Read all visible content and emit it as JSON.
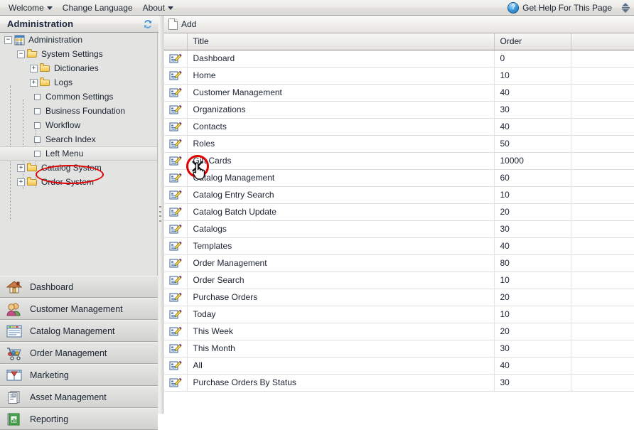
{
  "topbar": {
    "menu": [
      {
        "label": "Welcome",
        "caret": true
      },
      {
        "label": "Change Language",
        "caret": false
      },
      {
        "label": "About",
        "caret": true
      }
    ],
    "help_label": "Get Help For This Page",
    "help_icon": "question-mark-circle-icon",
    "expand_icon": "up-down-arrows-icon"
  },
  "left_panel": {
    "title": "Administration",
    "refresh_icon": "refresh-icon",
    "tree": [
      {
        "label": "Administration",
        "depth": 0,
        "icon": "admin-building-icon",
        "expander": "minus",
        "selected": false
      },
      {
        "label": "System Settings",
        "depth": 1,
        "icon": "folder-open-icon",
        "expander": "minus",
        "selected": false
      },
      {
        "label": "Dictionaries",
        "depth": 2,
        "icon": "folder-icon",
        "expander": "plus",
        "selected": false
      },
      {
        "label": "Logs",
        "depth": 2,
        "icon": "folder-icon",
        "expander": "plus",
        "selected": false
      },
      {
        "label": "Common Settings",
        "depth": 3,
        "icon": "none",
        "expander": "leaf",
        "selected": false
      },
      {
        "label": "Business Foundation",
        "depth": 3,
        "icon": "none",
        "expander": "leaf",
        "selected": false
      },
      {
        "label": "Workflow",
        "depth": 3,
        "icon": "none",
        "expander": "leaf",
        "selected": false
      },
      {
        "label": "Search Index",
        "depth": 3,
        "icon": "none",
        "expander": "leaf",
        "selected": false
      },
      {
        "label": "Left Menu",
        "depth": 3,
        "icon": "none",
        "expander": "leaf",
        "selected": true
      },
      {
        "label": "Catalog System",
        "depth": 1,
        "icon": "folder-icon",
        "expander": "plus",
        "selected": false
      },
      {
        "label": "Order System",
        "depth": 1,
        "icon": "folder-icon",
        "expander": "plus",
        "selected": false
      }
    ],
    "nav_buttons": [
      {
        "label": "Dashboard",
        "icon": "house-icon"
      },
      {
        "label": "Customer Management",
        "icon": "people-icon"
      },
      {
        "label": "Catalog Management",
        "icon": "catalog-window-icon"
      },
      {
        "label": "Order Management",
        "icon": "shopping-cart-icon"
      },
      {
        "label": "Marketing",
        "icon": "marketing-banner-icon"
      },
      {
        "label": "Asset Management",
        "icon": "assets-files-icon"
      },
      {
        "label": "Reporting",
        "icon": "report-book-icon"
      }
    ]
  },
  "content": {
    "toolbar": {
      "add_label": "Add",
      "add_icon": "new-page-icon"
    },
    "grid": {
      "columns": [
        "",
        "Title",
        "Order",
        ""
      ],
      "row_icon": "edit-row-icon",
      "rows": [
        {
          "title": "Dashboard",
          "order": "0",
          "indent": 0
        },
        {
          "title": "Home",
          "order": "10",
          "indent": 1
        },
        {
          "title": "Customer Management",
          "order": "40",
          "indent": 0
        },
        {
          "title": "Organizations",
          "order": "30",
          "indent": 1
        },
        {
          "title": "Contacts",
          "order": "40",
          "indent": 1
        },
        {
          "title": "Roles",
          "order": "50",
          "indent": 1
        },
        {
          "title": "Gift Cards",
          "order": "10000",
          "indent": 1
        },
        {
          "title": "Catalog Management",
          "order": "60",
          "indent": 0
        },
        {
          "title": "Catalog Entry Search",
          "order": "10",
          "indent": 1
        },
        {
          "title": "Catalog Batch Update",
          "order": "20",
          "indent": 1
        },
        {
          "title": "Catalogs",
          "order": "30",
          "indent": 1
        },
        {
          "title": "Templates",
          "order": "40",
          "indent": 1
        },
        {
          "title": "Order Management",
          "order": "80",
          "indent": 0
        },
        {
          "title": "Order Search",
          "order": "10",
          "indent": 1
        },
        {
          "title": "Purchase Orders",
          "order": "20",
          "indent": 1
        },
        {
          "title": "Today",
          "order": "10",
          "indent": 2
        },
        {
          "title": "This Week",
          "order": "20",
          "indent": 2
        },
        {
          "title": "This Month",
          "order": "30",
          "indent": 2
        },
        {
          "title": "All",
          "order": "40",
          "indent": 2
        },
        {
          "title": "Purchase Orders By Status",
          "order": "30",
          "indent": 1
        }
      ]
    }
  },
  "annotations": {
    "highlight_color": "#e00000",
    "circle_icon": "x-mark-circled-annotation",
    "cursor_icon": "hand-pointer-cursor"
  }
}
